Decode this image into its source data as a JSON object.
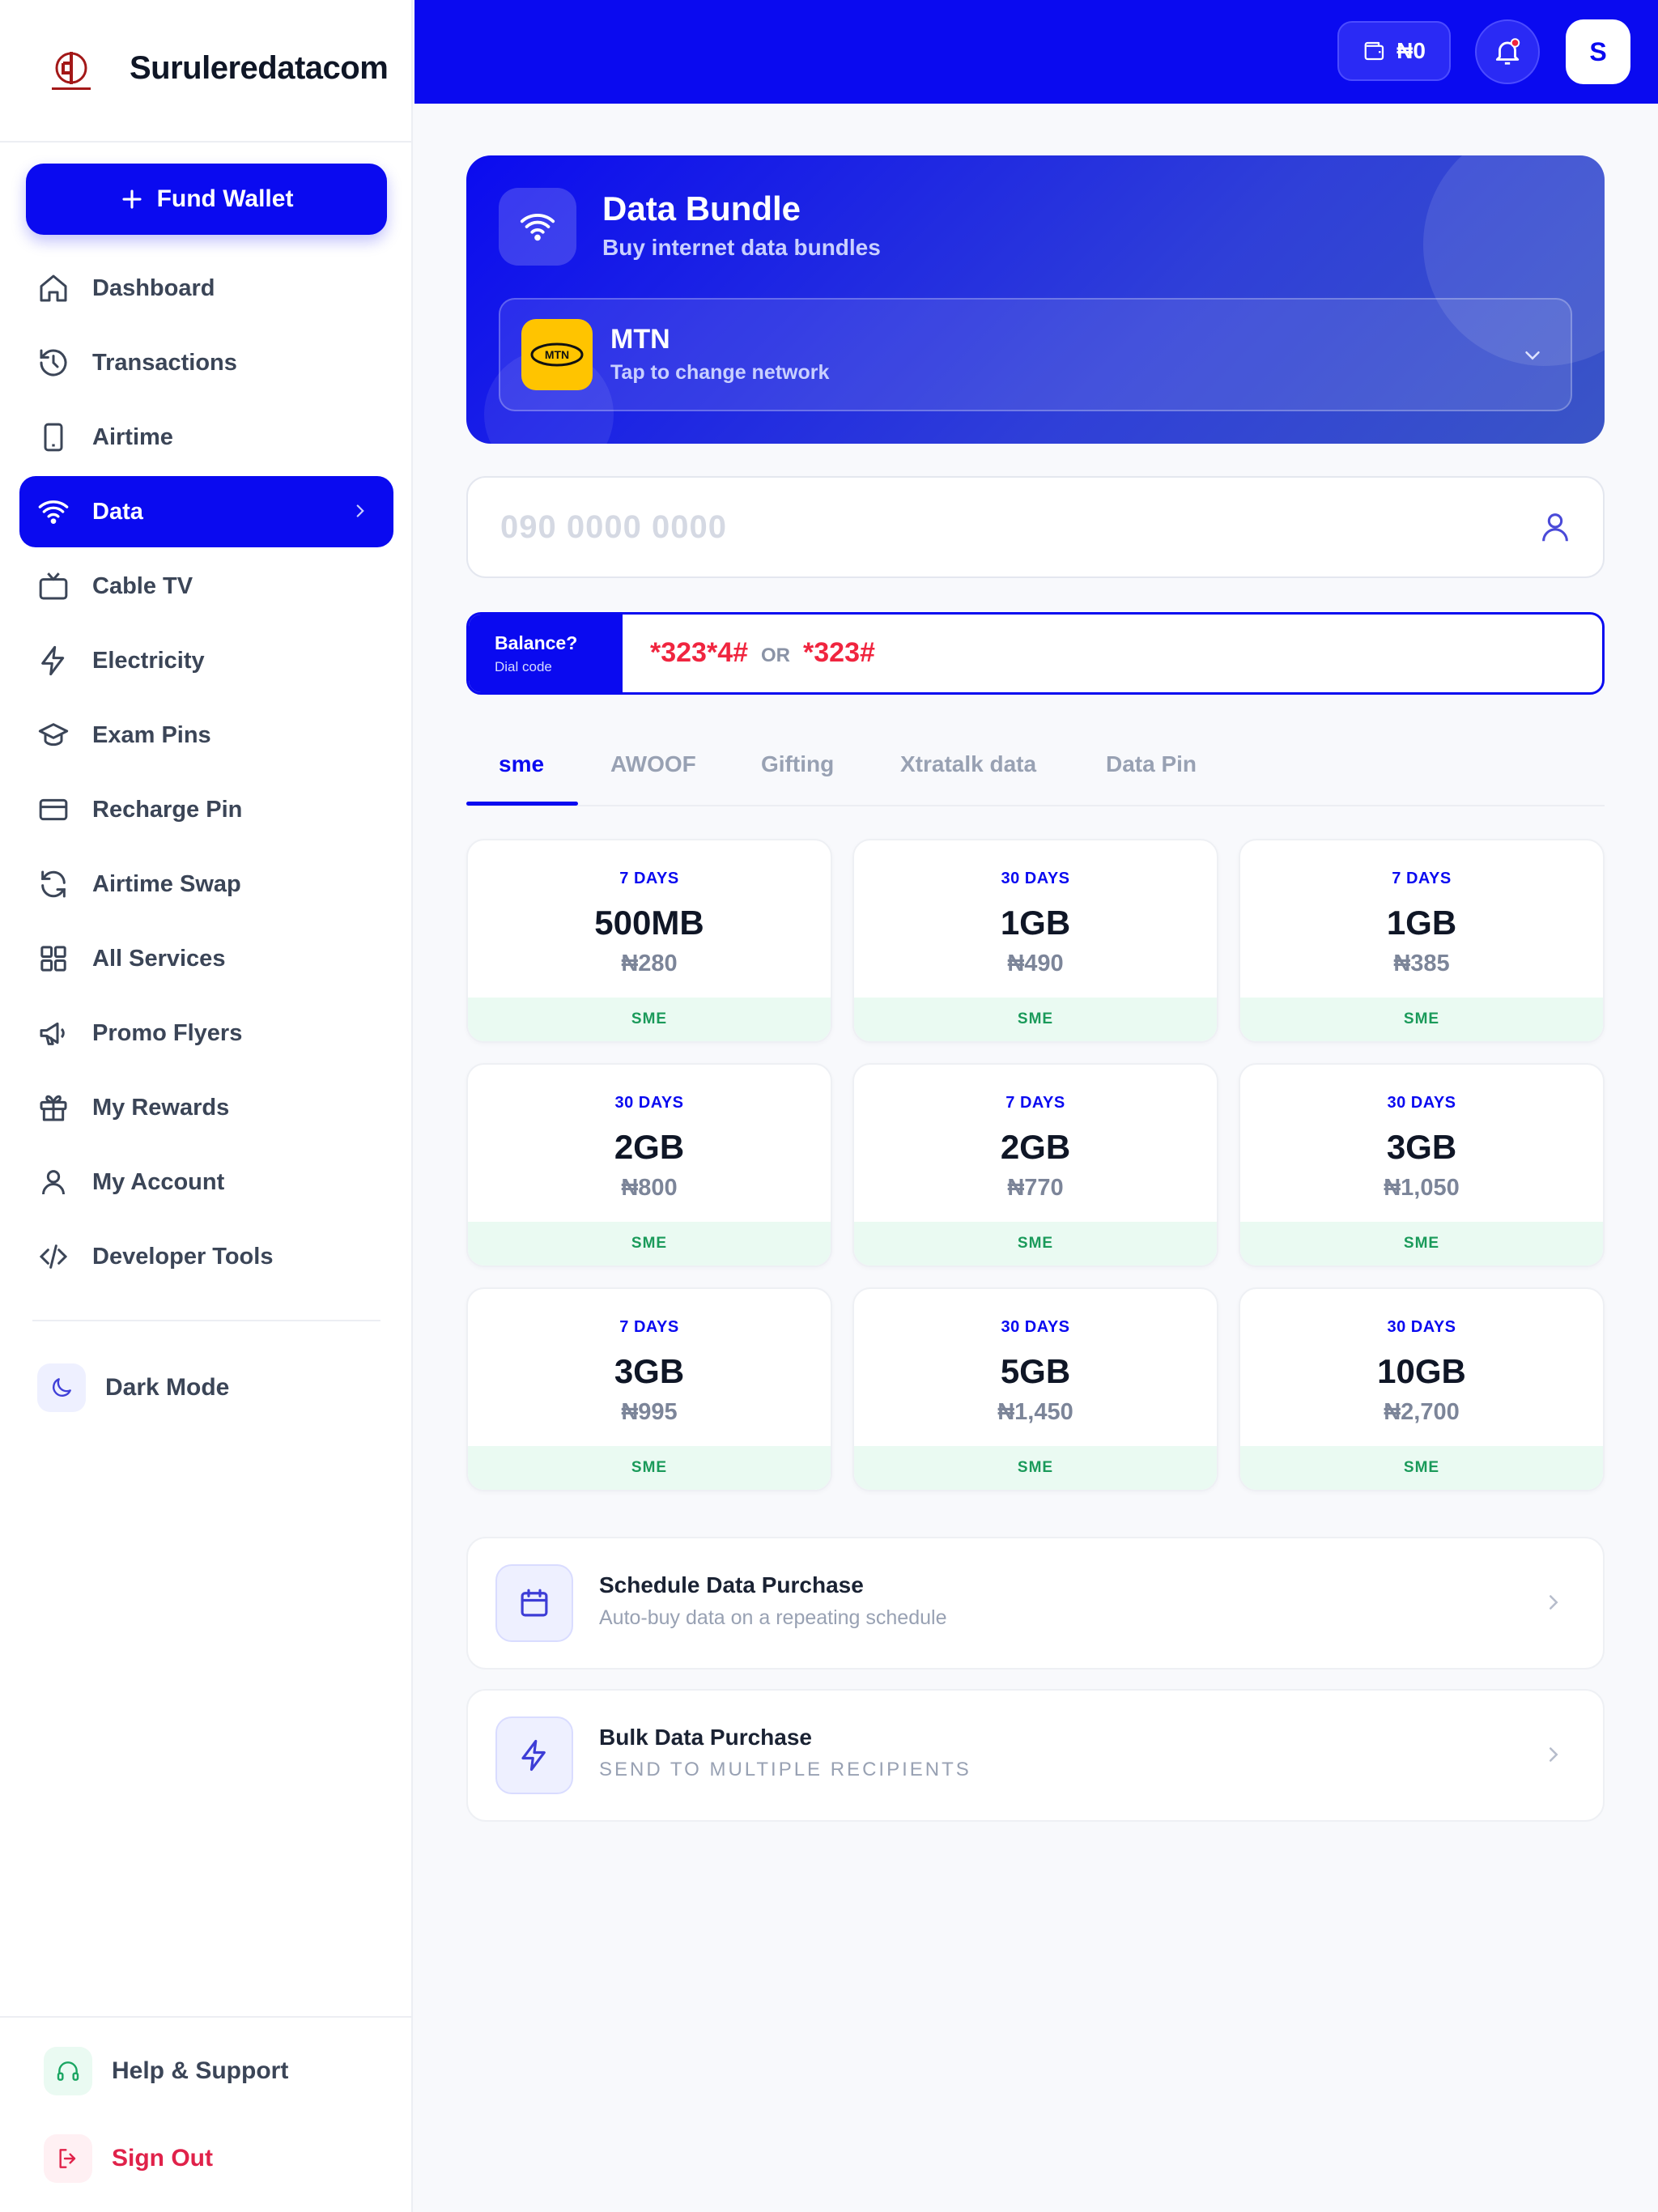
{
  "brand": {
    "name": "Suruleredatacom"
  },
  "sidebar": {
    "fund_label": "Fund Wallet",
    "items": [
      {
        "label": "Dashboard"
      },
      {
        "label": "Transactions"
      },
      {
        "label": "Airtime"
      },
      {
        "label": "Data"
      },
      {
        "label": "Cable TV"
      },
      {
        "label": "Electricity"
      },
      {
        "label": "Exam Pins"
      },
      {
        "label": "Recharge Pin"
      },
      {
        "label": "Airtime Swap"
      },
      {
        "label": "All Services"
      },
      {
        "label": "Promo Flyers"
      },
      {
        "label": "My Rewards"
      },
      {
        "label": "My Account"
      },
      {
        "label": "Developer Tools"
      }
    ],
    "active_item": "Data",
    "dark_mode_label": "Dark Mode",
    "help_label": "Help & Support",
    "signout_label": "Sign Out"
  },
  "topbar": {
    "wallet_label": "₦0",
    "avatar_initial": "S"
  },
  "hero": {
    "title": "Data Bundle",
    "subtitle": "Buy internet data bundles",
    "network_name": "MTN",
    "network_logo_text": "MTN",
    "network_hint": "Tap to change network"
  },
  "phone": {
    "placeholder": "090 0000 0000"
  },
  "balance": {
    "label": "Balance?",
    "sublabel": "Dial code",
    "code1": "*323*4#",
    "or": "OR",
    "code2": "*323#"
  },
  "tabs": [
    {
      "label": "sme"
    },
    {
      "label": "AWOOF"
    },
    {
      "label": "Gifting"
    },
    {
      "label": "Xtratalk data"
    },
    {
      "label": "Data Pin"
    }
  ],
  "active_tab": "sme",
  "plans": [
    {
      "duration": "7 DAYS",
      "size": "500MB",
      "price": "₦280",
      "type": "SME"
    },
    {
      "duration": "30 DAYS",
      "size": "1GB",
      "price": "₦490",
      "type": "SME"
    },
    {
      "duration": "7 DAYS",
      "size": "1GB",
      "price": "₦385",
      "type": "SME"
    },
    {
      "duration": "30 DAYS",
      "size": "2GB",
      "price": "₦800",
      "type": "SME"
    },
    {
      "duration": "7 DAYS",
      "size": "2GB",
      "price": "₦770",
      "type": "SME"
    },
    {
      "duration": "30 DAYS",
      "size": "3GB",
      "price": "₦1,050",
      "type": "SME"
    },
    {
      "duration": "7 DAYS",
      "size": "3GB",
      "price": "₦995",
      "type": "SME"
    },
    {
      "duration": "30 DAYS",
      "size": "5GB",
      "price": "₦1,450",
      "type": "SME"
    },
    {
      "duration": "30 DAYS",
      "size": "10GB",
      "price": "₦2,700",
      "type": "SME"
    }
  ],
  "actions": {
    "schedule": {
      "title": "Schedule Data Purchase",
      "subtitle": "Auto-buy data on a repeating schedule"
    },
    "bulk": {
      "title": "Bulk Data Purchase",
      "subtitle": "SEND TO MULTIPLE RECIPIENTS"
    }
  },
  "colors": {
    "primary": "#0a0af0",
    "success": "#1a9a5a",
    "danger": "#f0253f",
    "mtn_yellow": "#ffc400"
  }
}
